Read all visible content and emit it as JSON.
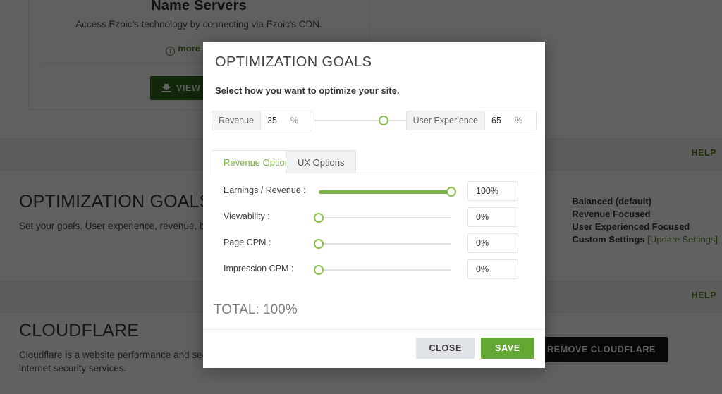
{
  "background": {
    "name_servers_card": {
      "title": "Name Servers",
      "subtitle": "Access Ezoic's technology by connecting via Ezoic's CDN.",
      "more_link": "more details",
      "info_icon": "info-icon",
      "install_button": "VIEW INSTALL INSTRUCTIONS",
      "install_icon": "download-icon"
    },
    "help_label": "HELP",
    "optimization_section": {
      "title": "OPTIMIZATION GOALS",
      "description": "Set your goals. User experience, revenue, balanced, or custom.",
      "options": [
        "Balanced (default)",
        "Revenue Focused",
        "User Experienced Focused",
        "Custom Settings"
      ],
      "update_link": "[Update Settings]"
    },
    "cloudflare_section": {
      "title": "CLOUDFLARE",
      "description_line1": "Cloudflare is a website performance and security company that provides DDoS",
      "description_line2": "mitigation and internet security services.",
      "remove_button": "REMOVE CLOUDFLARE"
    }
  },
  "modal": {
    "title": "OPTIMIZATION GOALS",
    "subtitle": "Select how you want to optimize your site.",
    "split": {
      "revenue_label": "Revenue",
      "revenue_value": "35",
      "revenue_pct": "%",
      "ux_label": "User Experience",
      "ux_value": "65",
      "ux_pct": "%",
      "knob_position_pct": 62
    },
    "tabs": [
      {
        "label": "Revenue Options",
        "active": true
      },
      {
        "label": "UX Options",
        "active": false
      }
    ],
    "sliders": [
      {
        "label": "Earnings / Revenue :",
        "value": "100%",
        "percent": 100
      },
      {
        "label": "Viewability :",
        "value": "0%",
        "percent": 0
      },
      {
        "label": "Page CPM :",
        "value": "0%",
        "percent": 0
      },
      {
        "label": "Impression CPM :",
        "value": "0%",
        "percent": 0
      }
    ],
    "total": "TOTAL: 100%",
    "close_button": "CLOSE",
    "save_button": "SAVE"
  },
  "colors": {
    "green_accent": "#7bb247",
    "green_dark": "#2f6b1f",
    "save_green": "#63a832",
    "link_green": "#4f7a21",
    "close_gray": "#dfe2e6",
    "remove_black": "#151515"
  }
}
